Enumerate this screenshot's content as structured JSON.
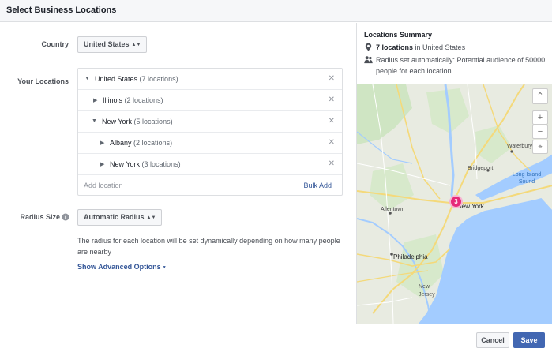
{
  "dialog": {
    "title": "Select Business Locations"
  },
  "country": {
    "label": "Country",
    "value": "United States"
  },
  "locations": {
    "label": "Your Locations",
    "rows": [
      {
        "name": "United States",
        "count": "(7 locations)",
        "expanded": true
      },
      {
        "name": "Illinois",
        "count": "(2 locations)",
        "expanded": false
      },
      {
        "name": "New York",
        "count": "(5 locations)",
        "expanded": true
      },
      {
        "name": "Albany",
        "count": "(2 locations)",
        "expanded": false
      },
      {
        "name": "New York",
        "count": "(3 locations)",
        "expanded": false
      }
    ],
    "add_placeholder": "Add location",
    "bulk_add": "Bulk Add"
  },
  "radius": {
    "label": "Radius Size",
    "value": "Automatic Radius",
    "help": "The radius for each location will be set dynamically depending on how many people are nearby",
    "advanced": "Show Advanced Options"
  },
  "summary": {
    "title": "Locations Summary",
    "locations_count": "7 locations",
    "locations_suffix": "in United States",
    "radius_text": "Radius set automatically: Potential audience of 50000 people for each location"
  },
  "map": {
    "cluster_count": "3",
    "labels": {
      "new_york": "New York",
      "philadelphia": "Philadelphia",
      "allentown": "Allentown",
      "bridgeport": "Bridgeport",
      "waterbury": "Waterbury",
      "long_island_sound": "Long Island Sound",
      "new_jersey": "New Jersey"
    },
    "colors": {
      "water": "#a3ccff",
      "land": "#e8ebe1",
      "park": "#cfe5c3",
      "highway": "#f4d97a",
      "cluster": "#e6297a"
    }
  },
  "footer": {
    "cancel": "Cancel",
    "save": "Save"
  },
  "icons": {
    "pin": "map-pin-icon",
    "people": "people-icon",
    "info": "info-icon",
    "remove": "close-icon"
  }
}
